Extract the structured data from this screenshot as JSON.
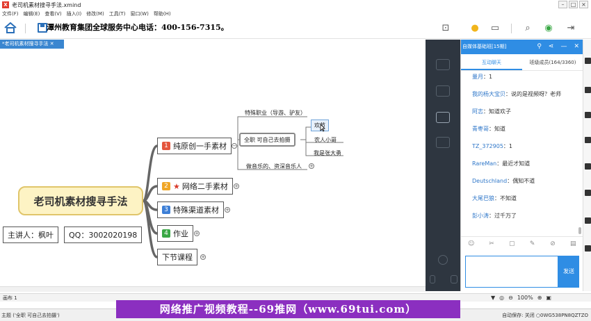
{
  "window": {
    "title": "老司机素材搜寻手法.xmind"
  },
  "menu": [
    "文件(F)",
    "编辑(E)",
    "查看(V)",
    "插入(I)",
    "修改(M)",
    "工具(T)",
    "窗口(W)",
    "帮助(H)"
  ],
  "toolbar": {
    "banner": "潭州教育集团全球服务中心电话：400-156-7315。"
  },
  "tab": {
    "label": "*老司机素材搜寻手法 ✕"
  },
  "mindmap": {
    "root": "老司机素材搜寻手法",
    "speaker": "主讲人：枫叶",
    "qq": "QQ：3002020198",
    "branch1": {
      "num": "1",
      "label": "纯原创一手素材"
    },
    "branch2": {
      "num": "2",
      "label": "网络二手素材"
    },
    "branch3": {
      "num": "3",
      "label": "特殊渠道素材"
    },
    "branch4": {
      "num": "4",
      "label": "作业"
    },
    "branch5": {
      "label": "下节课程"
    },
    "sub1": "特殊职业（导游、驴友）",
    "sub2": "全职 可自己去拍摄",
    "sub3": "做音乐的、资深音乐人",
    "leaf1": "欢节",
    "leaf2": "农人小哥",
    "leaf3": "我是张大勇"
  },
  "canvas_tab": "画布 1",
  "status": {
    "left": "主题 ('全职 可自己去拍摄')",
    "right": "自动保存: 关闭   ○0WG538PN8QZTZO"
  },
  "watermark": "网络推广视频教程--69推网（www.69tui.com）",
  "zoom": "100%",
  "chat": {
    "header": "自媒体基础班[15期]",
    "tab_chat": "互动聊天",
    "tab_members": "班级成员(164/3360)",
    "send": "发送",
    "messages": [
      {
        "user": "量月",
        "text": "1"
      },
      {
        "user": "我的杨大宝贝",
        "text": "说的是视频呀？老师"
      },
      {
        "user": "阿志",
        "text": "知道欢子"
      },
      {
        "user": "青枣哥",
        "text": "知道"
      },
      {
        "user": "TZ_372905",
        "text": "1"
      },
      {
        "user": "RareMan",
        "text": "最近才知道"
      },
      {
        "user": "Deutschland",
        "text": "偶知不道"
      },
      {
        "user": "大尾巴狼",
        "text": "不知道"
      },
      {
        "user": "彭小涛",
        "text": "过千万了"
      }
    ]
  },
  "colors": {
    "accent": "#2f8de4",
    "root_fill": "#fdf3c4",
    "watermark": "#8b2fc0",
    "num1": "#e4553d",
    "num2": "#f0a626",
    "num3": "#3d7fd6",
    "num4": "#3aa845"
  }
}
